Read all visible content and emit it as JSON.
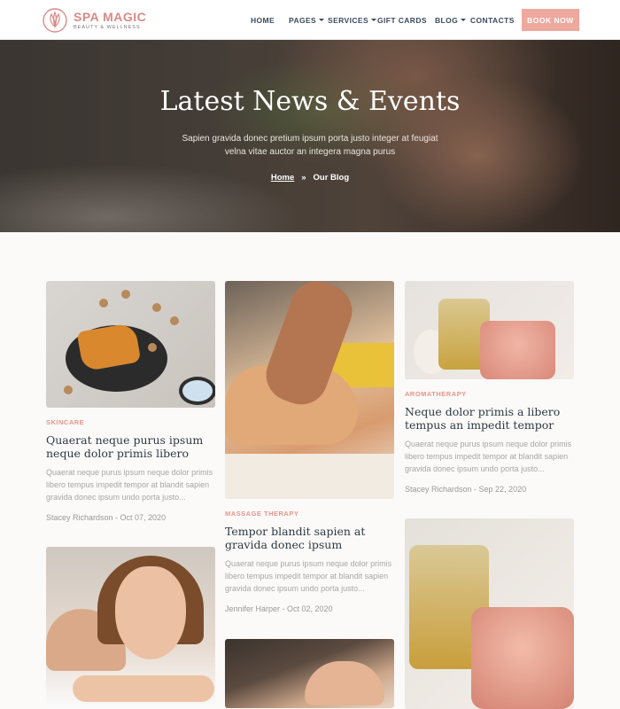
{
  "brand": {
    "name": "SPA MAGIC",
    "tagline": "BEAUTY & WELLNESS",
    "accent": "#eea89d",
    "category_color": "#e8948c"
  },
  "nav": {
    "items": [
      {
        "label": "HOME",
        "dropdown": false
      },
      {
        "label": "PAGES",
        "dropdown": true
      },
      {
        "label": "SERVICES",
        "dropdown": true
      },
      {
        "label": "GIFT CARDS",
        "dropdown": false
      },
      {
        "label": "BLOG",
        "dropdown": true
      },
      {
        "label": "CONTACTS",
        "dropdown": false
      }
    ],
    "cta": "BOOK NOW"
  },
  "hero": {
    "title": "Latest News & Events",
    "subtitle": "Sapien gravida donec pretium ipsum porta justo integer at feugiat velna vitae auctor an integera magna purus",
    "breadcrumb": {
      "home": "Home",
      "separator": "»",
      "current": "Our Blog"
    }
  },
  "posts": [
    {
      "category": "SKINCARE",
      "title": "Quaerat neque purus ipsum neque dolor primis libero",
      "excerpt": "Quaerat neque purus ipsum neque dolor primis libero tempus impedit tempor at blandit sapien gravida donec ipsum undo porta justo...",
      "meta": "Stacey Richardson - Oct 07, 2020"
    },
    {
      "category": "MASSAGE THERAPY",
      "title": "Tempor blandit sapien at gravida donec ipsum",
      "excerpt": "Quaerat neque purus ipsum neque dolor primis libero tempus impedit tempor at blandit sapien gravida donec ipsum undo porta justo...",
      "meta": "Jennifer Harper - Oct 02, 2020"
    },
    {
      "category": "AROMATHERAPY",
      "title": "Neque dolor primis a libero tempus an impedit tempor",
      "excerpt": "Quaerat neque purus ipsum neque dolor primis libero tempus impedit tempor at blandit sapien gravida donec ipsum undo porta justo...",
      "meta": "Stacey Richardson - Sep 22, 2020"
    }
  ]
}
